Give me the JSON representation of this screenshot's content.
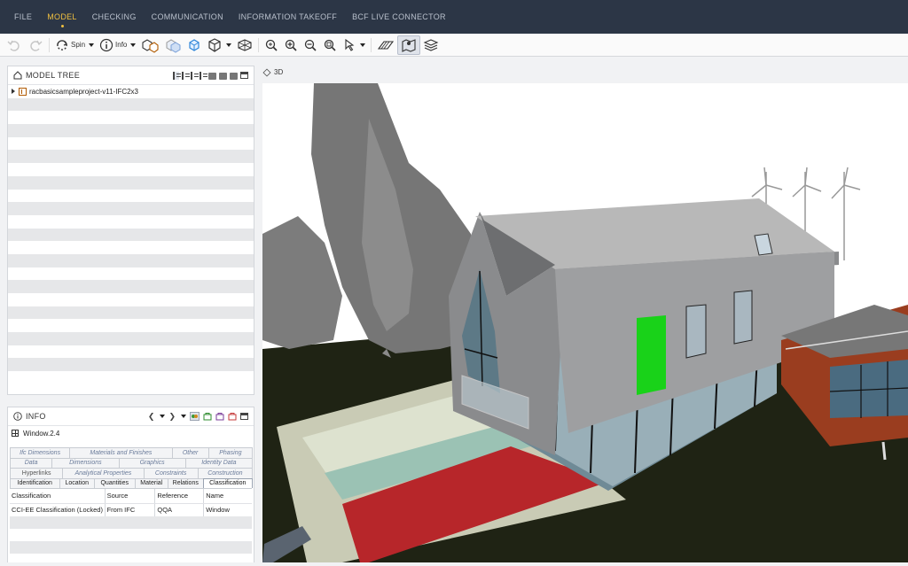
{
  "menu": [
    {
      "label": "FILE",
      "active": false
    },
    {
      "label": "MODEL",
      "active": true
    },
    {
      "label": "CHECKING",
      "active": false
    },
    {
      "label": "COMMUNICATION",
      "active": false
    },
    {
      "label": "INFORMATION TAKEOFF",
      "active": false
    },
    {
      "label": "BCF LIVE CONNECTOR",
      "active": false
    }
  ],
  "toolbar": {
    "spin_label": "Spin",
    "info_label": "Info"
  },
  "tree": {
    "title": "MODEL TREE",
    "root_item": "racbasicsampleproject-v11-IFC2x3"
  },
  "viewport": {
    "label": "3D",
    "selection_color": "#19d219"
  },
  "info": {
    "title": "INFO",
    "selected_element": "Window.2.4",
    "tab_rows": [
      [
        "Ifc Dimensions",
        "Materials and Finishes",
        "Other",
        "Phasing"
      ],
      [
        "Data",
        "Dimensions",
        "Graphics",
        "Identity Data"
      ],
      [
        "Hyperlinks",
        "Analytical Properties",
        "Constraints",
        "Construction"
      ],
      [
        "Identification",
        "Location",
        "Quantities",
        "Material",
        "Relations",
        "Classification"
      ]
    ],
    "active_tab": "Classification",
    "table": {
      "headers": [
        "Classification",
        "Source",
        "Reference",
        "Name"
      ],
      "rows": [
        [
          "CCI-EE Classification (Locked)",
          "From IFC",
          "QQA",
          "Window"
        ]
      ]
    }
  }
}
